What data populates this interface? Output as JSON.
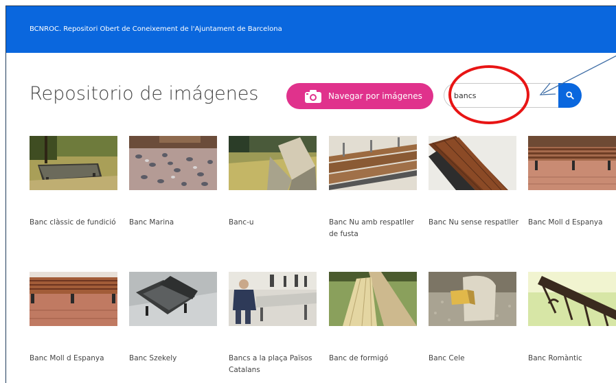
{
  "header": {
    "title": "BCNROC. Repositori Obert de Coneixement de l'Ajuntament de Barcelona"
  },
  "page": {
    "title": "Repositorio de imágenes"
  },
  "browse_button": {
    "label": "Navegar por imágenes",
    "icon": "camera-icon"
  },
  "search": {
    "value": "bancs",
    "icon": "search-icon"
  },
  "colors": {
    "header": "#0a67de",
    "browse": "#e0328c",
    "search_button": "#0a67de",
    "annotation": "#e81515",
    "arrow": "#3f6ea6"
  },
  "results": [
    {
      "label": "Banc clàssic de fundició"
    },
    {
      "label": "Banc Marina"
    },
    {
      "label": "Banc-u"
    },
    {
      "label": "Banc Nu amb respatller de fusta"
    },
    {
      "label": "Banc Nu sense respatller"
    },
    {
      "label": "Banc Moll d Espanya"
    },
    {
      "label": "Banc Moll d Espanya"
    },
    {
      "label": "Banc Szekely"
    },
    {
      "label": "Bancs a la plaça Països Catalans"
    },
    {
      "label": "Banc de formigó"
    },
    {
      "label": "Banc Cele"
    },
    {
      "label": "Banc Romàntic"
    }
  ]
}
